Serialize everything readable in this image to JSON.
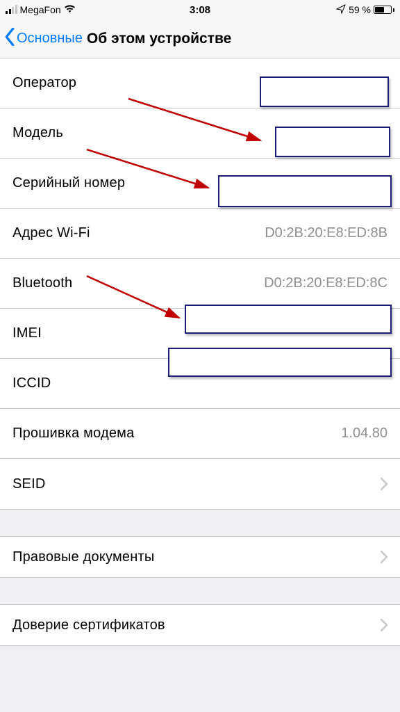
{
  "status": {
    "carrier": "MegaFon",
    "time": "3:08",
    "battery_pct": "59 %"
  },
  "nav": {
    "back_label": "Основные",
    "title": "Об этом устройстве"
  },
  "rows": {
    "operator": {
      "label": "Оператор"
    },
    "model": {
      "label": "Модель"
    },
    "serial": {
      "label": "Серийный номер"
    },
    "wifi": {
      "label": "Адрес Wi-Fi",
      "value": "D0:2B:20:E8:ED:8B"
    },
    "bluetooth": {
      "label": "Bluetooth",
      "value": "D0:2B:20:E8:ED:8C"
    },
    "imei": {
      "label": "IMEI"
    },
    "iccid": {
      "label": "ICCID"
    },
    "modem": {
      "label": "Прошивка модема",
      "value": "1.04.80"
    },
    "seid": {
      "label": "SEID"
    },
    "legal": {
      "label": "Правовые документы"
    },
    "cert": {
      "label": "Доверие сертификатов"
    }
  }
}
